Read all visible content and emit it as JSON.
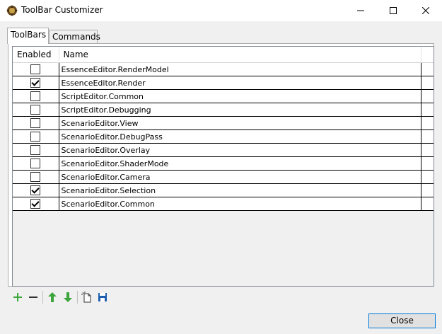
{
  "window": {
    "title": "ToolBar Customizer"
  },
  "tabs": [
    {
      "label": "ToolBars"
    },
    {
      "label": "Commands"
    }
  ],
  "grid": {
    "columns": [
      "Enabled",
      "Name"
    ],
    "rows": [
      {
        "enabled": false,
        "name": "EssenceEditor.RenderModel"
      },
      {
        "enabled": true,
        "name": "EssenceEditor.Render"
      },
      {
        "enabled": false,
        "name": "ScriptEditor.Common"
      },
      {
        "enabled": false,
        "name": "ScriptEditor.Debugging"
      },
      {
        "enabled": false,
        "name": "ScenarioEditor.View"
      },
      {
        "enabled": false,
        "name": "ScenarioEditor.DebugPass"
      },
      {
        "enabled": false,
        "name": "ScenarioEditor.Overlay"
      },
      {
        "enabled": false,
        "name": "ScenarioEditor.ShaderMode"
      },
      {
        "enabled": false,
        "name": "ScenarioEditor.Camera"
      },
      {
        "enabled": true,
        "name": "ScenarioEditor.Selection"
      },
      {
        "enabled": true,
        "name": "ScenarioEditor.Common"
      }
    ]
  },
  "toolbar": {
    "icons": [
      "add-icon",
      "remove-icon",
      "move-up-icon",
      "move-down-icon",
      "new-file-icon",
      "save-icon"
    ]
  },
  "buttons": {
    "close_label": "Close"
  },
  "colors": {
    "accent": "#0078d7",
    "green": "#3ca53c",
    "save_blue": "#1f5fae"
  }
}
